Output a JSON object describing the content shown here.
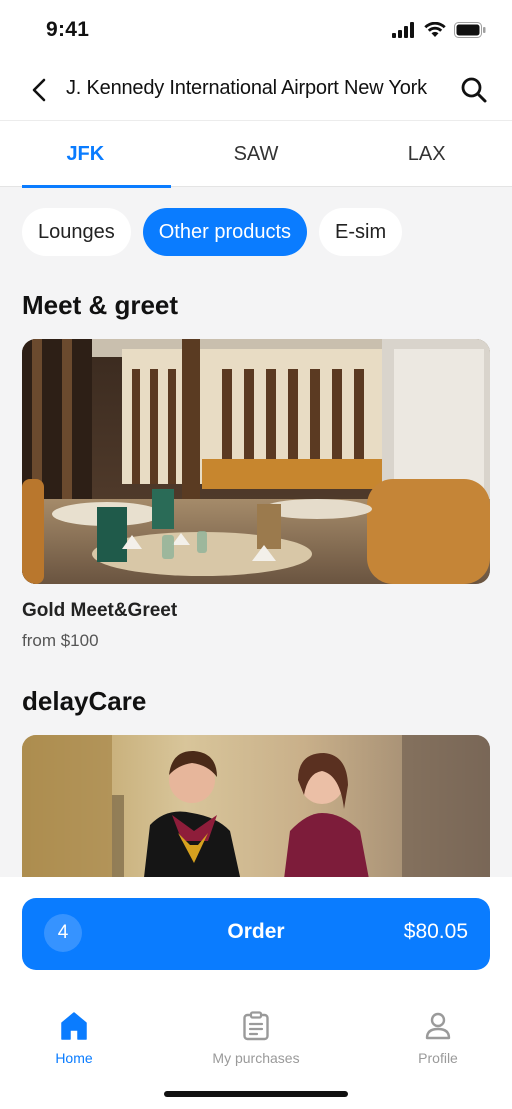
{
  "status_bar": {
    "time": "9:41"
  },
  "header": {
    "title": "J. Kennedy International Airport New York"
  },
  "tabs": [
    {
      "label": "JFK",
      "active": true
    },
    {
      "label": "SAW",
      "active": false
    },
    {
      "label": "LAX",
      "active": false
    }
  ],
  "chips": [
    {
      "label": "Lounges",
      "active": false
    },
    {
      "label": "Other products",
      "active": true
    },
    {
      "label": "E-sim",
      "active": false
    }
  ],
  "sections": [
    {
      "title": "Meet & greet",
      "card": {
        "name": "Gold Meet&Greet",
        "price": "from $100"
      }
    },
    {
      "title": "delayCare",
      "card": {
        "name": "",
        "price": ""
      }
    }
  ],
  "order": {
    "count": "4",
    "label": "Order",
    "total": "$80.05"
  },
  "nav": [
    {
      "label": "Home",
      "icon": "home-icon",
      "active": true
    },
    {
      "label": "My purchases",
      "icon": "clipboard-icon",
      "active": false
    },
    {
      "label": "Profile",
      "icon": "user-icon",
      "active": false
    }
  ],
  "colors": {
    "accent": "#0a7cff",
    "background": "#f4f4f5",
    "inactive": "#9a9a9a"
  }
}
